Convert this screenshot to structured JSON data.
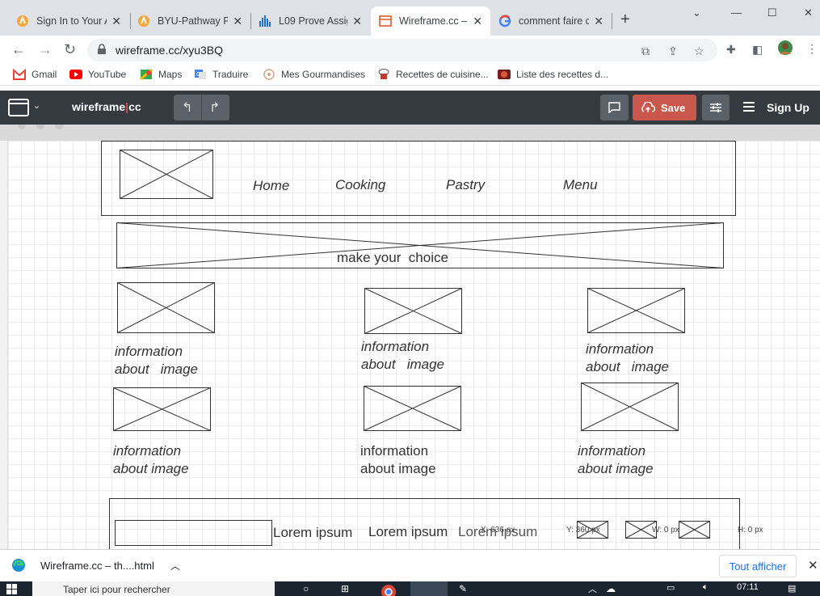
{
  "browser": {
    "tabs": [
      {
        "title": "Sign In to Your A",
        "active": false,
        "icon": "byu-pathway-icon"
      },
      {
        "title": "BYU-Pathway Po",
        "active": false,
        "icon": "byu-pathway-icon"
      },
      {
        "title": "L09 Prove Assig",
        "active": false,
        "icon": "chart-bars-icon"
      },
      {
        "title": "Wireframe.cc –",
        "active": true,
        "icon": "wireframe-icon"
      },
      {
        "title": "comment faire c",
        "active": false,
        "icon": "google-icon"
      }
    ],
    "url": "wireframe.cc/xyu3BQ",
    "bookmarks": [
      {
        "label": "Gmail",
        "icon": "gmail-icon"
      },
      {
        "label": "YouTube",
        "icon": "youtube-icon"
      },
      {
        "label": "Maps",
        "icon": "maps-icon"
      },
      {
        "label": "Traduire",
        "icon": "translate-icon"
      },
      {
        "label": "Mes Gourmandises",
        "icon": "gourmandises-icon"
      },
      {
        "label": "Recettes de cuisine...",
        "icon": "chef-icon"
      },
      {
        "label": "Liste des recettes d...",
        "icon": "recipe-icon"
      }
    ]
  },
  "app": {
    "brand_left": "wireframe",
    "brand_sep": "|",
    "brand_right": "cc",
    "save_label": "Save",
    "signup_label": "Sign Up",
    "accent_color": "#c9574b"
  },
  "wireframe": {
    "nav": [
      "Home",
      "Cooking",
      "Pastry",
      "Menu"
    ],
    "banner_text": "make your  choice",
    "row1_captions": [
      "information\nabout   image",
      "information\nabout   image",
      "information\nabout   image"
    ],
    "row2_captions": [
      "information\nabout image",
      "information\nabout image",
      "information\nabout image"
    ],
    "footer_texts": [
      "Lorem ipsum",
      "Lorem ipsum",
      "Lorem ipsum"
    ],
    "readout": {
      "x": "X: 636 px",
      "y": "Y: 360 px",
      "w": "W: 0 px",
      "h": "H: 0 px"
    }
  },
  "downloads": {
    "file": "Wireframe.cc – th....html",
    "show_all": "Tout afficher"
  },
  "taskbar": {
    "search_placeholder": "Taper ici pour rechercher",
    "time": "07:11"
  }
}
